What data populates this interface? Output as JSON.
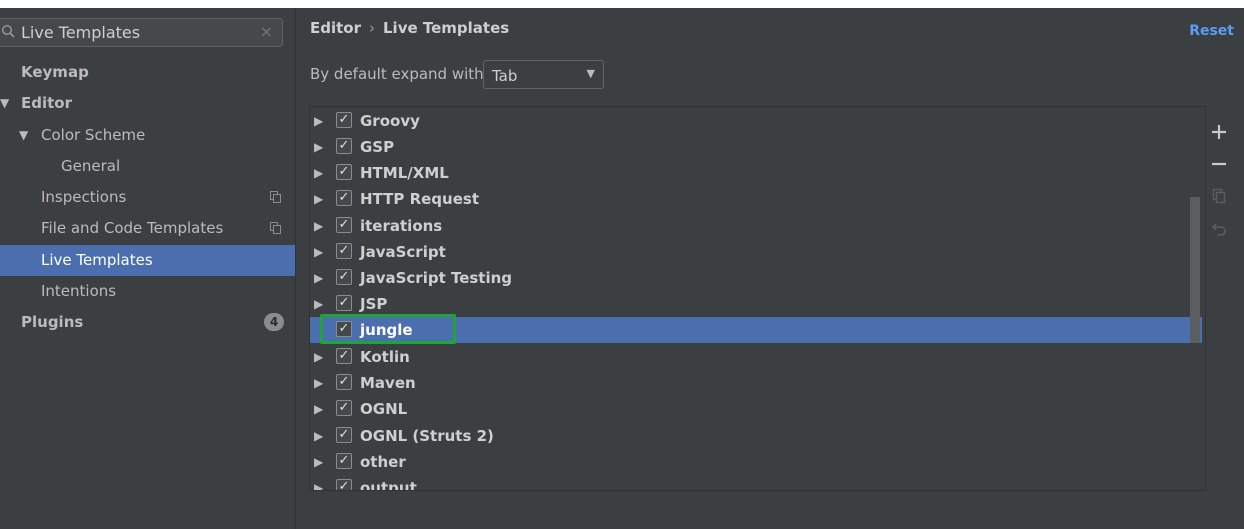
{
  "search": {
    "value": "Live Templates",
    "clear_symbol": "×"
  },
  "sidebar": {
    "items": [
      {
        "label": "Keymap"
      },
      {
        "label": "Editor",
        "arrow": "▼"
      },
      {
        "label": "Color Scheme",
        "arrow": "▼"
      },
      {
        "label": "General"
      },
      {
        "label": "Inspections"
      },
      {
        "label": "File and Code Templates"
      },
      {
        "label": "Live Templates",
        "selected": true
      },
      {
        "label": "Intentions"
      },
      {
        "label": "Plugins",
        "badge": "4"
      }
    ]
  },
  "header": {
    "crumb_parent": "Editor",
    "crumb_separator": "›",
    "crumb_current": "Live Templates",
    "reset_label": "Reset"
  },
  "expand": {
    "label": "By default expand with",
    "value": "Tab",
    "caret": "▼"
  },
  "templates": {
    "expand_arrow": "▶",
    "check_mark": "✓",
    "groups": [
      {
        "name": "Groovy",
        "checked": true
      },
      {
        "name": "GSP",
        "checked": true
      },
      {
        "name": "HTML/XML",
        "checked": true
      },
      {
        "name": "HTTP Request",
        "checked": true
      },
      {
        "name": "iterations",
        "checked": true
      },
      {
        "name": "JavaScript",
        "checked": true
      },
      {
        "name": "JavaScript Testing",
        "checked": true
      },
      {
        "name": "JSP",
        "checked": true
      },
      {
        "name": "jungle",
        "checked": true,
        "selected": true,
        "highlighted": true
      },
      {
        "name": "Kotlin",
        "checked": true
      },
      {
        "name": "Maven",
        "checked": true
      },
      {
        "name": "OGNL",
        "checked": true
      },
      {
        "name": "OGNL (Struts 2)",
        "checked": true
      },
      {
        "name": "other",
        "checked": true
      },
      {
        "name": "output",
        "checked": true
      }
    ]
  },
  "toolbar": {
    "icons": [
      "plus-icon",
      "minus-icon",
      "copy-icon",
      "undo-icon"
    ]
  },
  "colors": {
    "background": "#3c3f41",
    "selection": "#4b6eaf",
    "link": "#589df6",
    "highlight_frame": "#22a33a"
  }
}
